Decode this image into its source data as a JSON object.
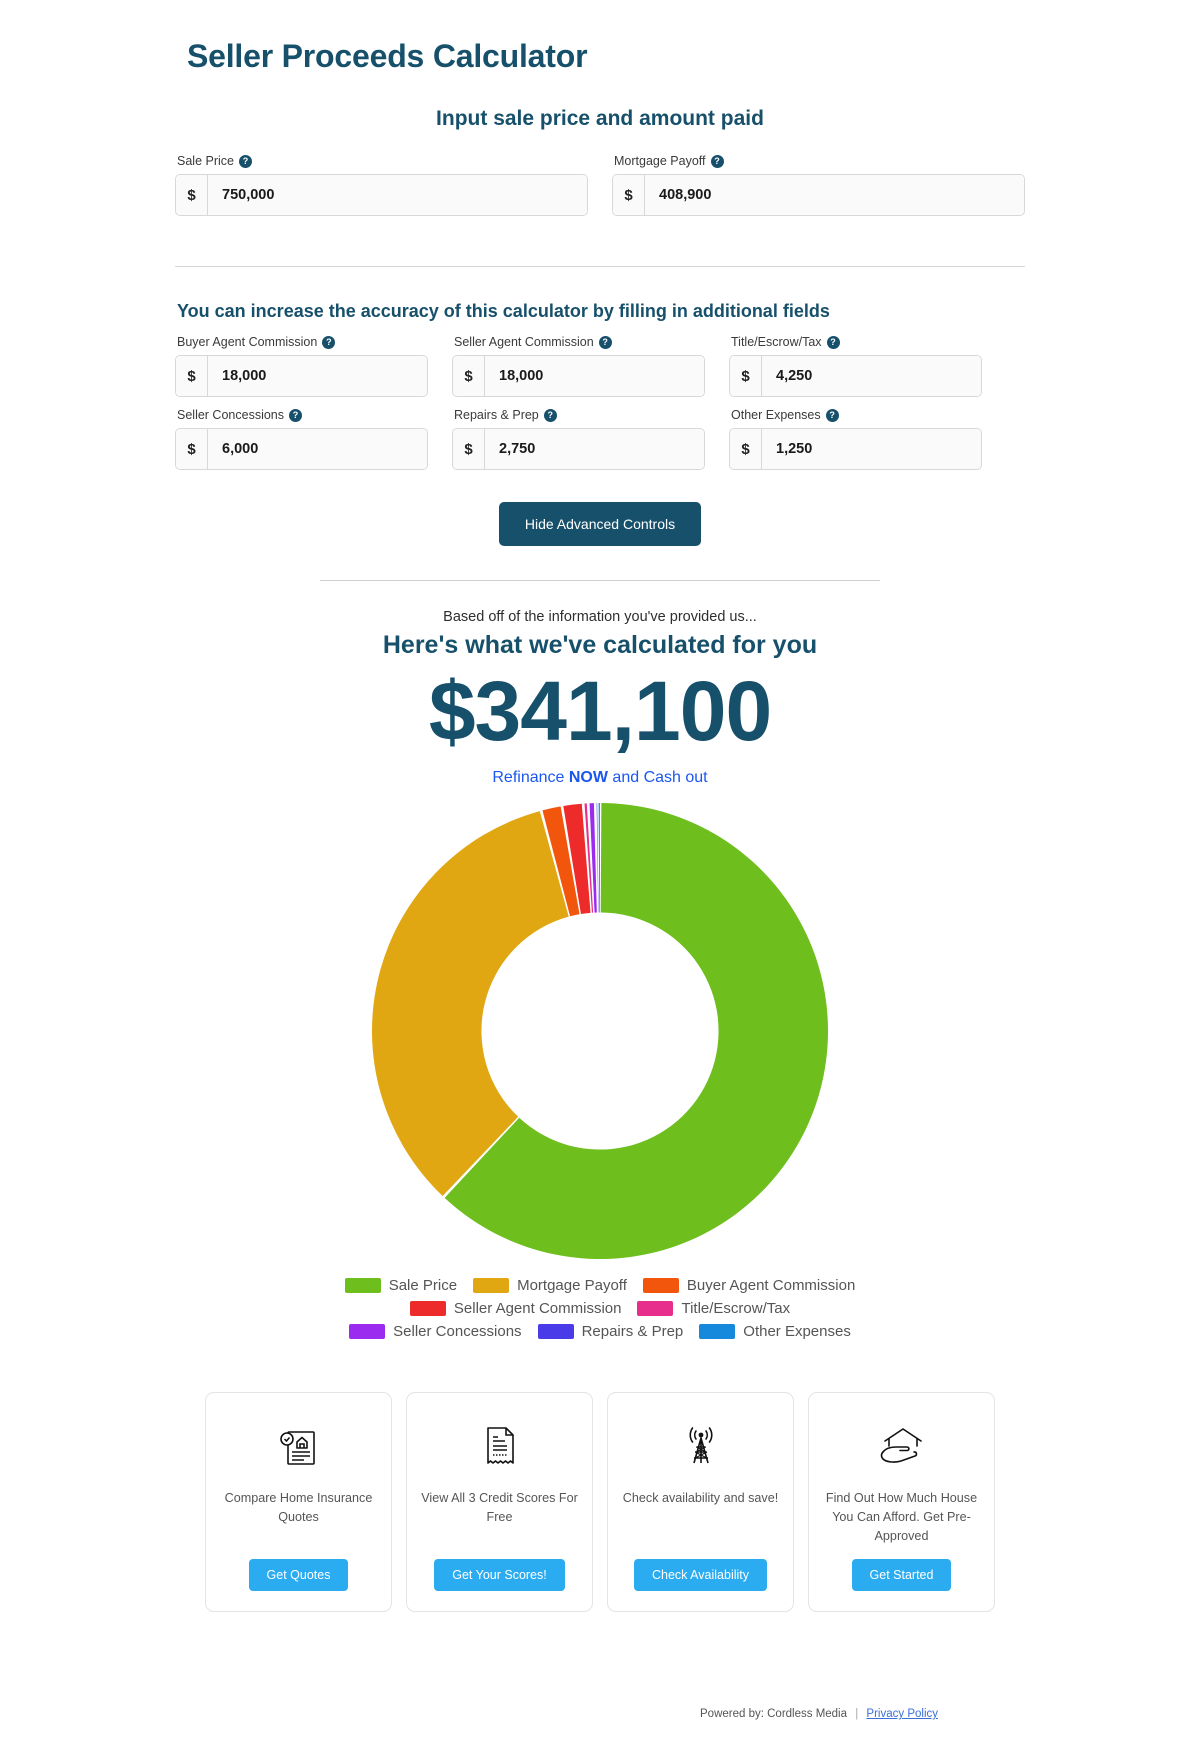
{
  "header": {
    "app_title": "Seller Proceeds Calculator",
    "section_title": "Input sale price and amount paid",
    "advanced_title": "You can increase the accuracy of this calculator by filling in additional fields"
  },
  "currency_symbol": "$",
  "help_glyph": "?",
  "primary_fields": [
    {
      "label": "Sale Price",
      "value": "750,000",
      "name": "sale-price"
    },
    {
      "label": "Mortgage Payoff",
      "value": "408,900",
      "name": "mortgage-payoff"
    }
  ],
  "advanced_fields": [
    {
      "label": "Buyer Agent Commission",
      "value": "18,000",
      "name": "buyer-agent-commission"
    },
    {
      "label": "Seller Agent Commission",
      "value": "18,000",
      "name": "seller-agent-commission"
    },
    {
      "label": "Title/Escrow/Tax",
      "value": "4,250",
      "name": "title-escrow-tax"
    },
    {
      "label": "Seller Concessions",
      "value": "6,000",
      "name": "seller-concessions"
    },
    {
      "label": "Repairs & Prep",
      "value": "2,750",
      "name": "repairs-and-prep"
    },
    {
      "label": "Other Expenses",
      "value": "1,250",
      "name": "other-expenses"
    }
  ],
  "toggle_advanced_label": "Hide Advanced Controls",
  "results": {
    "lead": "Based off of the information you've provided us...",
    "heading": "Here's what we've calculated for you",
    "amount": "$341,100",
    "link_prefix": "Refinance ",
    "link_emphasis": "NOW",
    "link_suffix": " and Cash out"
  },
  "chart_data": {
    "type": "pie",
    "variant": "donut",
    "title": "",
    "legend_position": "bottom",
    "inner_radius_ratio": 0.52,
    "start_angle_deg": -90,
    "categories": [
      "Sale Price",
      "Mortgage Payoff",
      "Buyer Agent Commission",
      "Seller Agent Commission",
      "Title/Escrow/Tax",
      "Seller Concessions",
      "Repairs & Prep",
      "Other Expenses"
    ],
    "values": [
      750000,
      408900,
      18000,
      18000,
      4250,
      6000,
      2750,
      1250
    ],
    "colors": [
      "#6ebe1e",
      "#e0a712",
      "#f2560c",
      "#ee2b2b",
      "#e82e8c",
      "#9b2bee",
      "#4a3be8",
      "#1789dc"
    ],
    "total": 1209150
  },
  "promo_cards": [
    {
      "icon": "home-insurance-document-icon",
      "text": "Compare Home Insurance Quotes",
      "button": "Get Quotes"
    },
    {
      "icon": "credit-score-receipt-icon",
      "text": "View All 3 Credit Scores For Free",
      "button": "Get Your Scores!"
    },
    {
      "icon": "signal-tower-icon",
      "text": "Check availability and save!",
      "button": "Check Availability"
    },
    {
      "icon": "house-in-hand-icon",
      "text": "Find Out How Much House You Can Afford. Get Pre-Approved",
      "button": "Get Started"
    }
  ],
  "footer": {
    "powered_by": "Powered by: Cordless Media",
    "separator": "|",
    "privacy_link": "Privacy Policy"
  }
}
